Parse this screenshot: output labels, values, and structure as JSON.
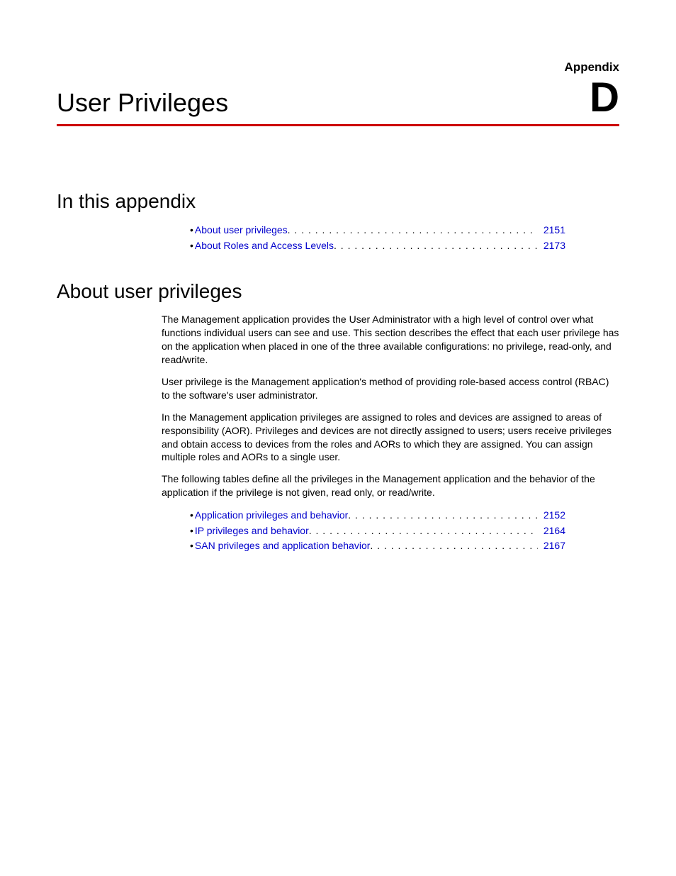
{
  "header": {
    "appendix_label": "Appendix",
    "chapter_title": "User Privileges",
    "chapter_letter": "D"
  },
  "sections": {
    "in_this_appendix": {
      "heading": "In this appendix",
      "items": [
        {
          "label": "About user privileges",
          "page": "2151"
        },
        {
          "label": "About Roles and Access Levels",
          "page": "2173"
        }
      ]
    },
    "about_user_privileges": {
      "heading": "About user privileges",
      "paragraphs": [
        "The Management application provides the User Administrator with a high level of control over what functions individual users can see and use. This section describes the effect that each user privilege has on the application when placed in one of the three available configurations: no privilege, read-only, and read/write.",
        "User privilege is the Management application's method of providing role-based access control (RBAC) to the software's user administrator.",
        "In the Management application privileges are assigned to roles and devices are assigned to areas of responsibility (AOR). Privileges and devices are not directly assigned to users; users receive privileges and obtain access to devices from the roles and AORs to which they are assigned. You can assign multiple roles and AORs to a single user.",
        "The following tables define all the privileges in the Management application and the behavior of the application if the privilege is not given, read only, or read/write."
      ],
      "items": [
        {
          "label": "Application privileges and behavior",
          "page": "2152"
        },
        {
          "label": "IP privileges and behavior",
          "page": "2164"
        },
        {
          "label": "SAN privileges and application behavior",
          "page": "2167"
        }
      ]
    }
  }
}
